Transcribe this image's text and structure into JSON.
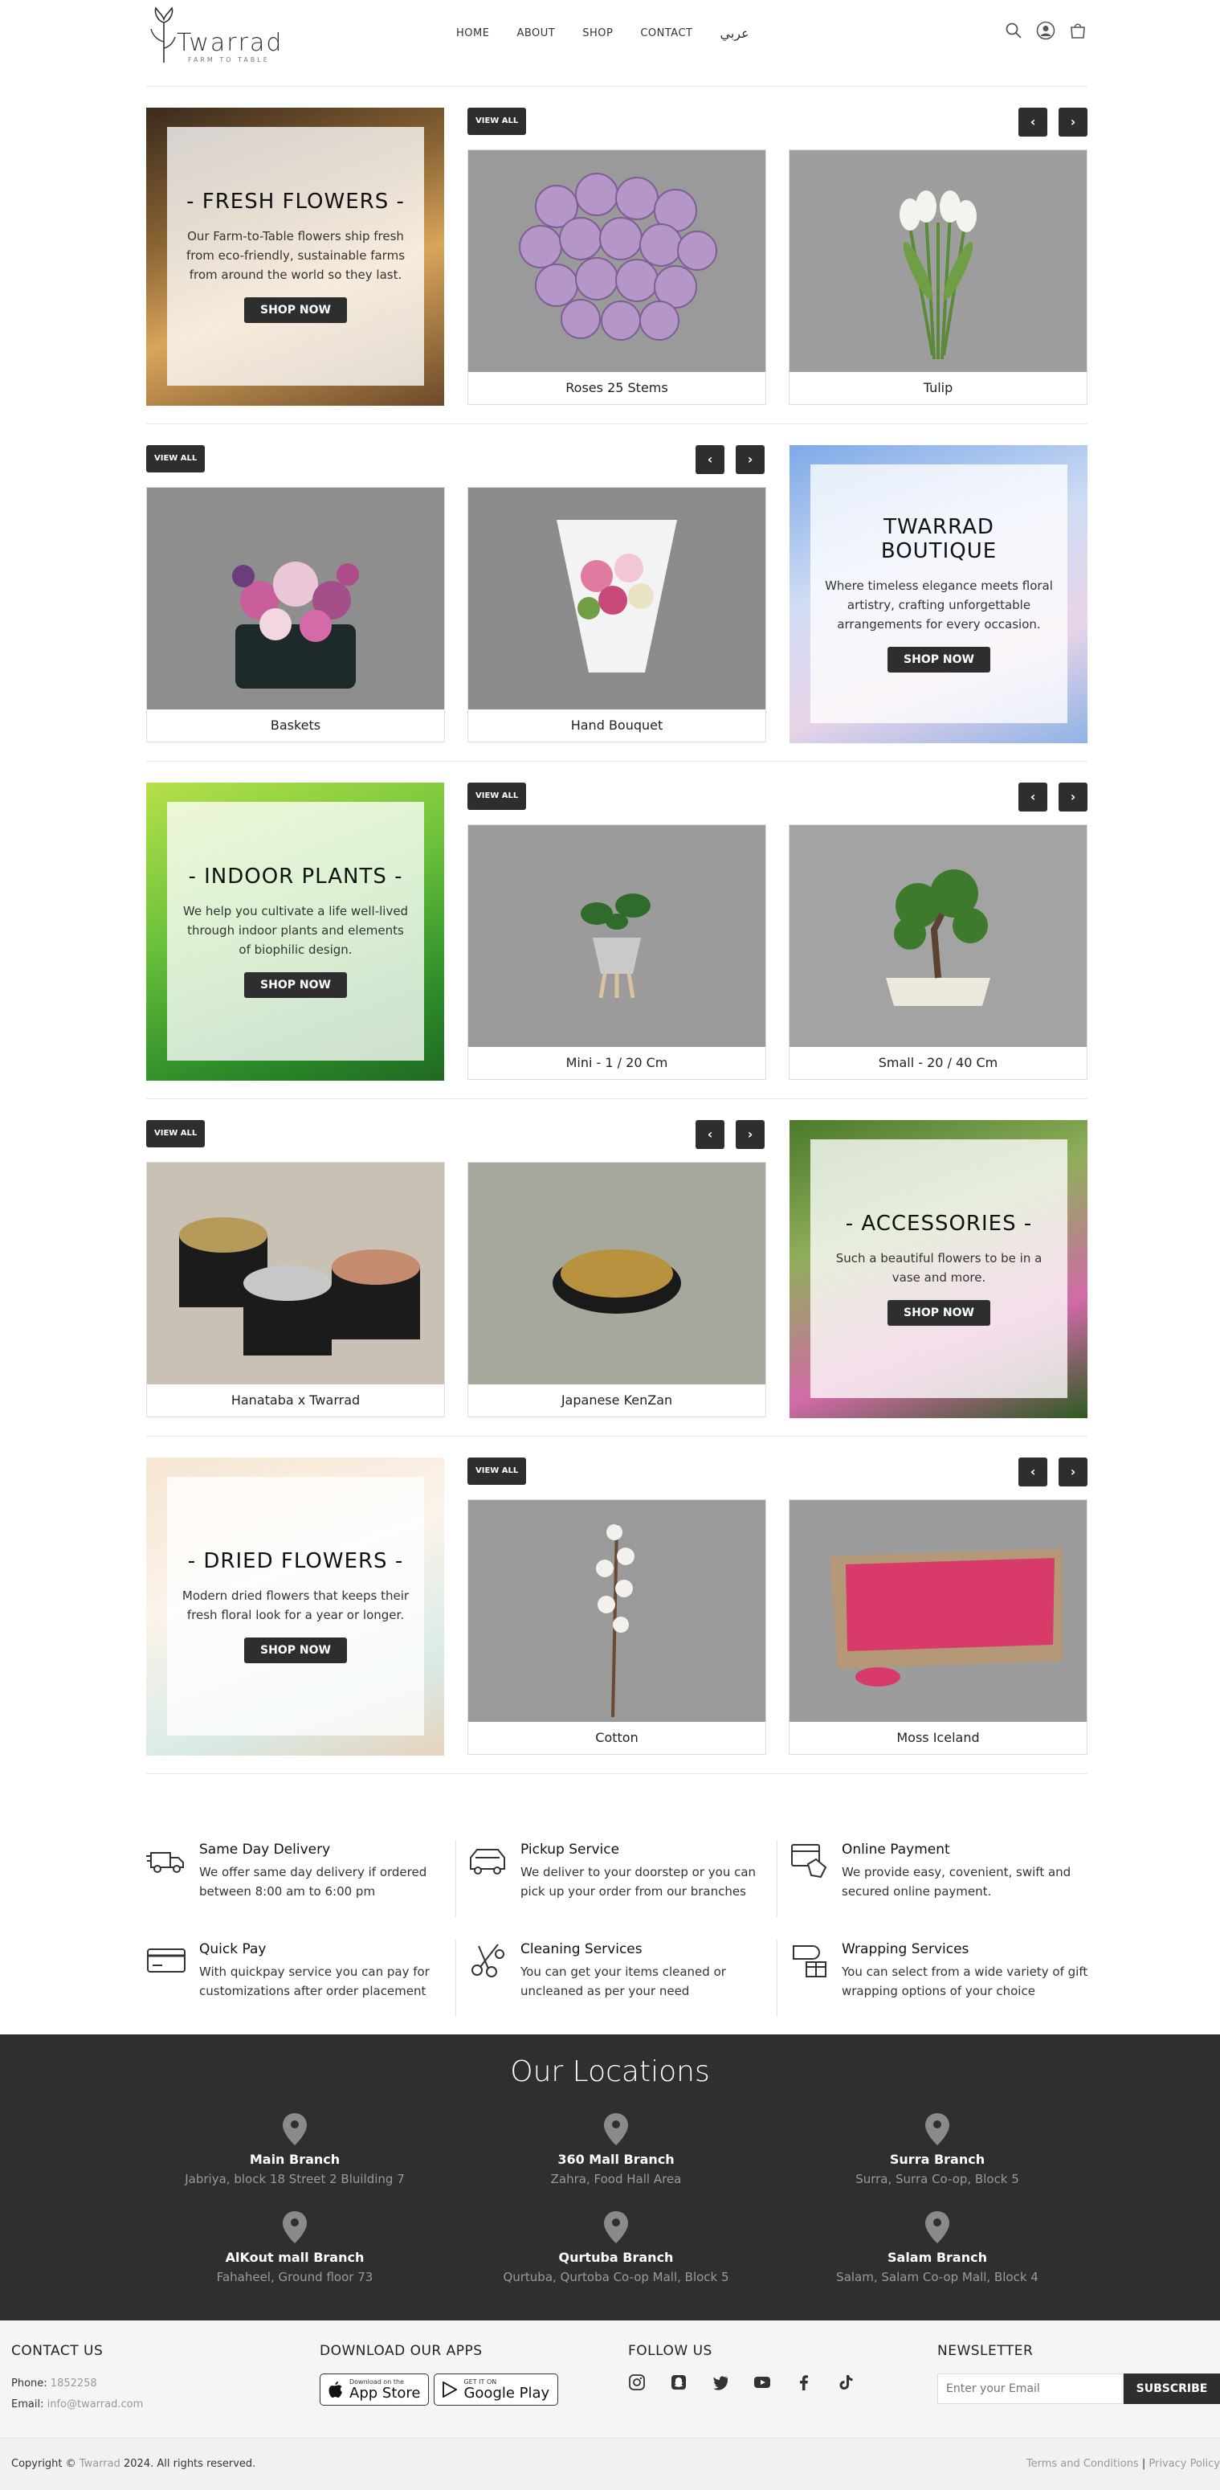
{
  "header": {
    "logo_word": "Twarrad",
    "logo_tag": "FARM TO TABLE",
    "nav": [
      "HOME",
      "ABOUT",
      "SHOP",
      "CONTACT",
      "عربي"
    ]
  },
  "common": {
    "view_all": "VIEW ALL",
    "shop_now": "SHOP NOW",
    "prev": "‹",
    "next": "›"
  },
  "sections": [
    {
      "promo": {
        "title": "- FRESH FLOWERS -",
        "text": "Our Farm-to-Table flowers ship fresh from eco-friendly, sustainable farms from around the world so they last."
      },
      "products": [
        "Roses 25 Stems",
        "Tulip"
      ]
    },
    {
      "promo": {
        "title": "TWARRAD BOUTIQUE",
        "text": "Where timeless elegance meets floral artistry, crafting unforgettable arrangements for every occasion."
      },
      "products": [
        "Baskets",
        "Hand Bouquet"
      ]
    },
    {
      "promo": {
        "title": "- INDOOR PLANTS -",
        "text": "We help you cultivate a life well-lived through indoor plants and elements of biophilic design."
      },
      "products": [
        "Mini - 1 / 20 Cm",
        "Small - 20 / 40 Cm"
      ]
    },
    {
      "promo": {
        "title": "- ACCESSORIES -",
        "text": "Such a beautiful flowers to be in a vase and more."
      },
      "products": [
        "Hanataba x Twarrad",
        "Japanese KenZan"
      ]
    },
    {
      "promo": {
        "title": "- DRIED FLOWERS -",
        "text": "Modern dried flowers that keeps their fresh floral look for a year or longer."
      },
      "products": [
        "Cotton",
        "Moss Iceland"
      ]
    }
  ],
  "services": [
    {
      "icon": "delivery-truck-icon",
      "title": "Same Day Delivery",
      "text": "We offer same day delivery if ordered between 8:00 am to 6:00 pm"
    },
    {
      "icon": "pickup-van-icon",
      "title": "Pickup Service",
      "text": "We deliver to your doorstep or you can pick up your order from our branches"
    },
    {
      "icon": "online-payment-icon",
      "title": "Online Payment",
      "text": "We provide easy, covenient, swift and secured online payment."
    },
    {
      "icon": "credit-card-icon",
      "title": "Quick Pay",
      "text": "With quickpay service you can pay for customizations after order placement"
    },
    {
      "icon": "scissors-icon",
      "title": "Cleaning Services",
      "text": "You can get your items cleaned or uncleaned as per your need"
    },
    {
      "icon": "gift-wrap-icon",
      "title": "Wrapping Services",
      "text": "You can select from a wide variety of gift wrapping options of your choice"
    }
  ],
  "locations": {
    "title": "Our Locations",
    "items": [
      {
        "name": "Main Branch",
        "address": "Jabriya, block 18 Street 2 Bluilding 7"
      },
      {
        "name": "360 Mall Branch",
        "address": "Zahra, Food Hall Area"
      },
      {
        "name": "Surra Branch",
        "address": "Surra, Surra Co-op, Block 5"
      },
      {
        "name": "AlKout mall Branch",
        "address": "Fahaheel, Ground floor 73"
      },
      {
        "name": "Qurtuba Branch",
        "address": "Qurtuba, Qurtoba Co-op Mall, Block 5"
      },
      {
        "name": "Salam Branch",
        "address": "Salam, Salam Co-op Mall, Block 4"
      }
    ]
  },
  "footer": {
    "contact_title": "CONTACT US",
    "phone_label": "Phone:",
    "phone": "1852258",
    "email_label": "Email:",
    "email": "info@twarrad.com",
    "apps_title": "DOWNLOAD OUR APPS",
    "appstore_small": "Download on the",
    "appstore_big": "App Store",
    "googleplay_small": "GET IT ON",
    "googleplay_big": "Google Play",
    "follow_title": "FOLLOW US",
    "newsletter_title": "NEWSLETTER",
    "newsletter_placeholder": "Enter your Email",
    "subscribe": "SUBSCRIBE"
  },
  "copyright": {
    "prefix": "Copyright ©",
    "brand": "Twarrad",
    "suffix": "2024. All rights reserved.",
    "terms": "Terms and Conditions",
    "separator": "|",
    "privacy": "Privacy Policy"
  }
}
